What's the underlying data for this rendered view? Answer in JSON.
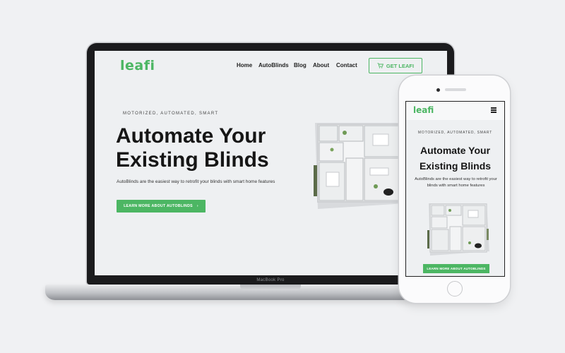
{
  "brand": {
    "accent": "#4cb663"
  },
  "laptop": {
    "device_label": "MacBook Pro",
    "nav": {
      "logo": "leafi",
      "links": [
        "Home",
        "AutoBlinds",
        "Blog",
        "About",
        "Contact"
      ],
      "cta_label": "GET LEAFI",
      "cta_icon": "cart-icon"
    },
    "hero": {
      "eyebrow": "MOTORIZED, AUTOMATED, SMART",
      "title_line1": "Automate Your",
      "title_line2": "Existing Blinds",
      "subtitle": "AutoBlinds are the easiest way to retrofit your blinds with smart home features",
      "cta_label": "LEARN MORE ABOUT AUTOBLINDS",
      "cta_icon": "chevron-right-icon"
    }
  },
  "phone": {
    "nav": {
      "logo": "leafi",
      "menu_icon": "hamburger-icon"
    },
    "hero": {
      "eyebrow": "MOTORIZED, AUTOMATED, SMART",
      "title_line1": "Automate Your",
      "title_line2": "Existing Blinds",
      "subtitle": "AutoBlinds are the easiest way to retrofit your blinds with smart home features",
      "cta_label": "LEARN MORE ABOUT AUTOBLINDS"
    }
  }
}
